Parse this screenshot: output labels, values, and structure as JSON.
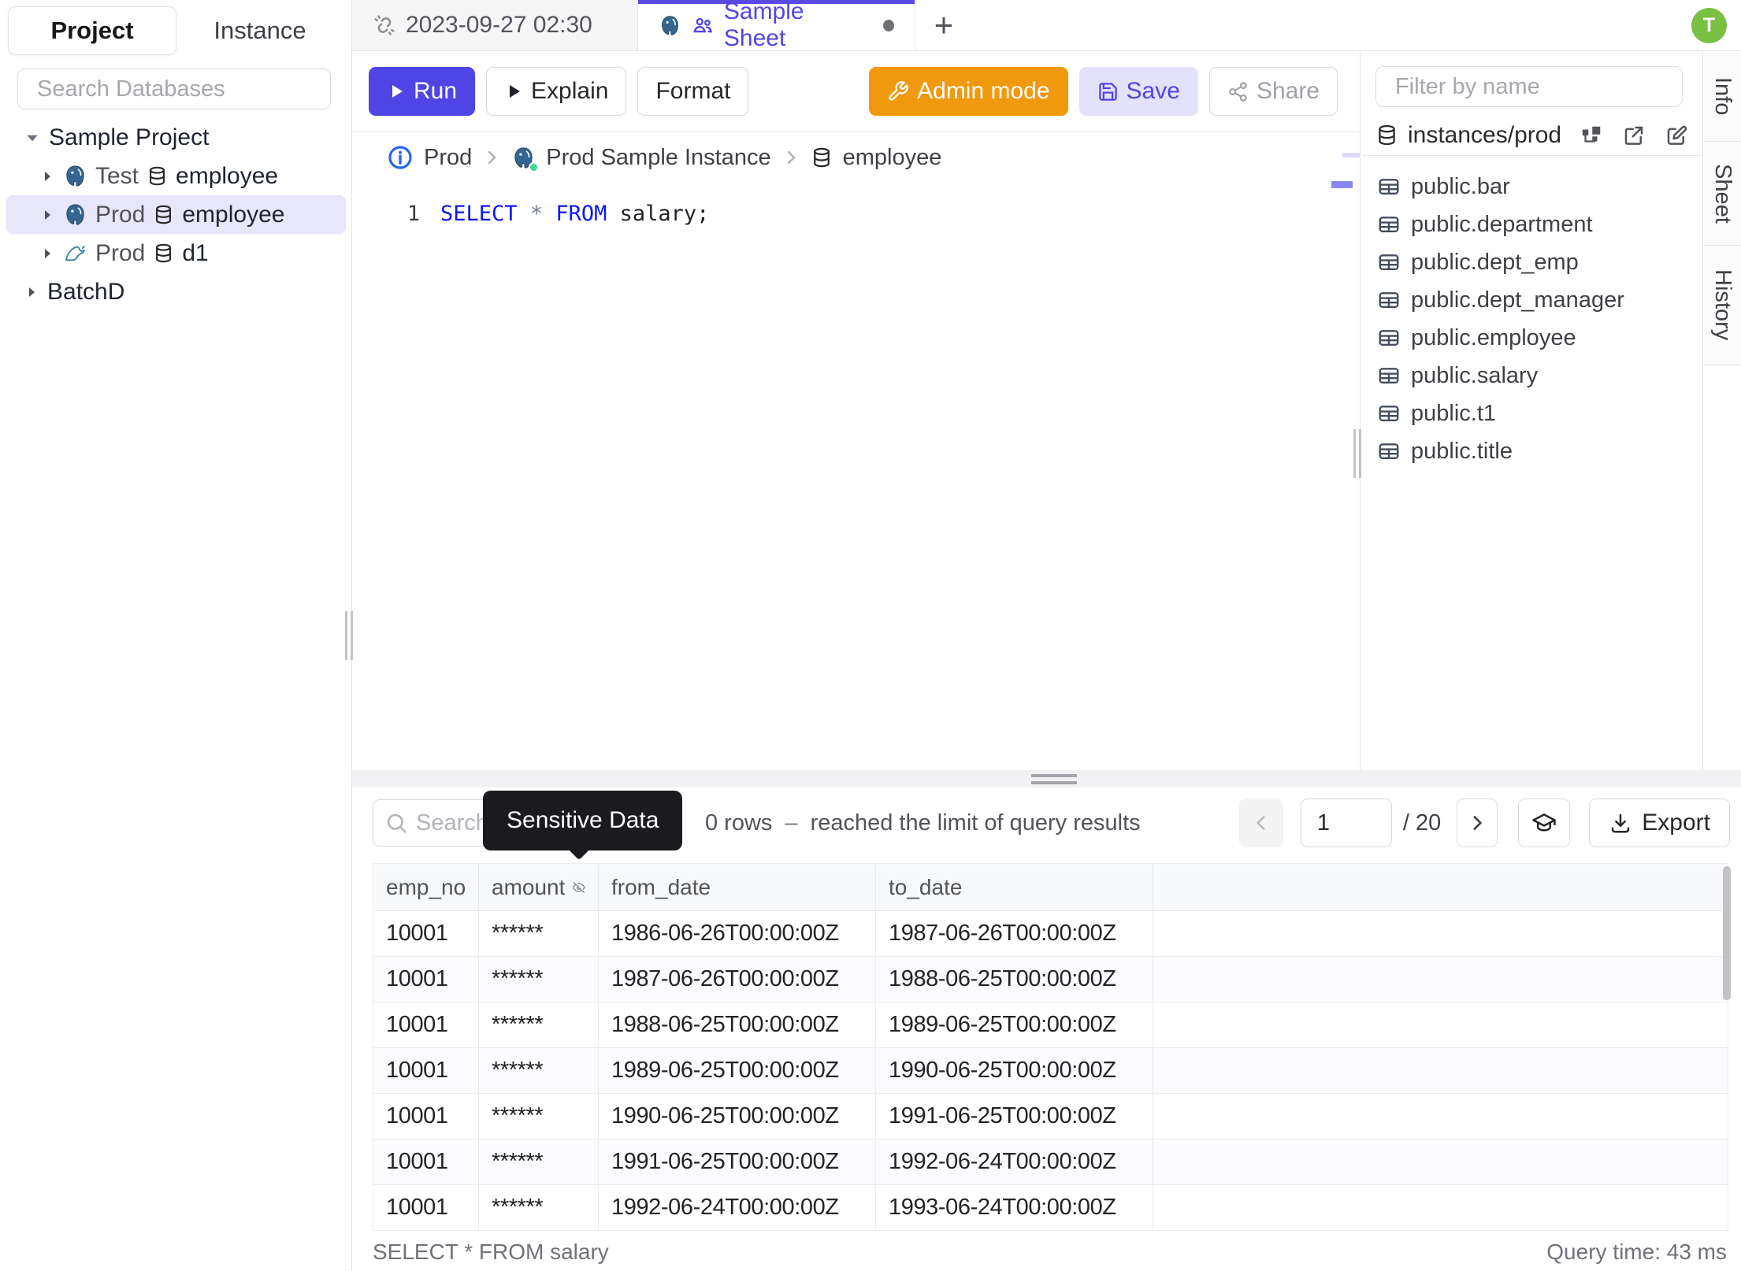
{
  "colors": {
    "accent": "#4f45e4",
    "admin_orange": "#f0990e",
    "avatar_green": "#7ac143",
    "keyword_blue": "#0d18ef",
    "tooltip_bg": "#1b1b1f"
  },
  "user": {
    "avatar_initial": "T"
  },
  "sidebar": {
    "tabs": {
      "project": "Project",
      "instance": "Instance"
    },
    "search_placeholder": "Search Databases",
    "project_group": "Sample Project",
    "tree": [
      {
        "env": "Test",
        "engine": "postgres",
        "db": "employee"
      },
      {
        "env": "Prod",
        "engine": "postgres",
        "db": "employee"
      },
      {
        "env": "Prod",
        "engine": "mysql",
        "db": "d1"
      }
    ],
    "extra_project": "BatchD"
  },
  "tabbar": {
    "tab1_label": "2023-09-27 02:30",
    "tab2_label": "Sample Sheet",
    "new_tab": "+"
  },
  "toolbar": {
    "run": "Run",
    "explain": "Explain",
    "format": "Format",
    "admin_mode": "Admin mode",
    "save": "Save",
    "share": "Share"
  },
  "breadcrumb": {
    "env": "Prod",
    "instance": "Prod Sample Instance",
    "database": "employee"
  },
  "editor": {
    "line_number": "1",
    "kw1": "SELECT",
    "star": "*",
    "kw2": "FROM",
    "rest": " salary;"
  },
  "right_panel": {
    "filter_placeholder": "Filter by name",
    "source": "instances/prod",
    "tables": [
      "public.bar",
      "public.department",
      "public.dept_emp",
      "public.dept_manager",
      "public.employee",
      "public.salary",
      "public.t1",
      "public.title"
    ]
  },
  "side_tabs": {
    "info": "Info",
    "sheet": "Sheet",
    "history": "History"
  },
  "results": {
    "search_placeholder": "Search",
    "tooltip": "Sensitive Data",
    "rows_count": "0 rows",
    "separator": "–",
    "limit_note": "reached the limit of query results",
    "page": "1",
    "page_total": "/ 20",
    "export_label": "Export",
    "columns": {
      "c1": "emp_no",
      "c2": "amount",
      "c3": "from_date",
      "c4": "to_date"
    },
    "rows": [
      {
        "emp_no": "10001",
        "amount": "******",
        "from_date": "1986-06-26T00:00:00Z",
        "to_date": "1987-06-26T00:00:00Z"
      },
      {
        "emp_no": "10001",
        "amount": "******",
        "from_date": "1987-06-26T00:00:00Z",
        "to_date": "1988-06-25T00:00:00Z"
      },
      {
        "emp_no": "10001",
        "amount": "******",
        "from_date": "1988-06-25T00:00:00Z",
        "to_date": "1989-06-25T00:00:00Z"
      },
      {
        "emp_no": "10001",
        "amount": "******",
        "from_date": "1989-06-25T00:00:00Z",
        "to_date": "1990-06-25T00:00:00Z"
      },
      {
        "emp_no": "10001",
        "amount": "******",
        "from_date": "1990-06-25T00:00:00Z",
        "to_date": "1991-06-25T00:00:00Z"
      },
      {
        "emp_no": "10001",
        "amount": "******",
        "from_date": "1991-06-25T00:00:00Z",
        "to_date": "1992-06-24T00:00:00Z"
      },
      {
        "emp_no": "10001",
        "amount": "******",
        "from_date": "1992-06-24T00:00:00Z",
        "to_date": "1993-06-24T00:00:00Z"
      }
    ],
    "status_sql": "SELECT * FROM salary",
    "query_time": "Query time: 43 ms"
  }
}
